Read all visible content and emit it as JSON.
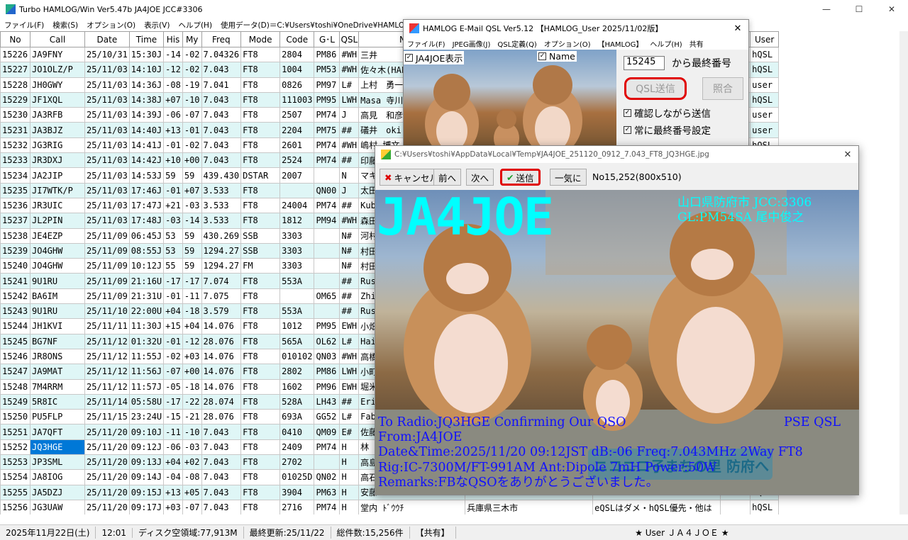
{
  "main_window": {
    "title": "Turbo HAMLOG/Win Ver5.47b JA4JOE JCC#3306",
    "controls": [
      "—",
      "☐",
      "✕"
    ],
    "menu": [
      "ファイル(F)",
      "検索(S)",
      "オプション(O)",
      "表示(V)",
      "ヘルプ(H)",
      "使用データ(D)＝C:¥Users¥toshi¥OneDrive¥HAMLOG¥Hamlog.hdb",
      "再"
    ]
  },
  "log": {
    "columns": [
      "No",
      "Call",
      "Date",
      "Time",
      "His",
      "My",
      "Freq",
      "Mode",
      "Code",
      "G･L",
      "QSL",
      "Name",
      "",
      "Remarks２",
      "DC12",
      "User"
    ],
    "rows": [
      [
        "15226",
        "JA9FNY",
        "25/10/31",
        "15:30J",
        "-14",
        "-02",
        "7.04326",
        "FT8",
        "2804",
        "PM86",
        "#WH",
        "三井",
        "",
        "対応。h-QSL、e-QSL、",
        "",
        "hQSL"
      ],
      [
        "15227",
        "JO1OLZ/P",
        "25/11/03",
        "14:10J",
        "-12",
        "-02",
        "7.043",
        "FT8",
        "1004",
        "PM53",
        "#WH",
        "佐々木(HAL)",
        "",
        "ろ勉強中,CW QRQ聴取も",
        "",
        "hQSL"
      ],
      [
        "15228",
        "JH0GWY",
        "25/11/03",
        "14:36J",
        "-08",
        "-19",
        "7.041",
        "FT8",
        "0826",
        "PM97",
        "L#",
        "上村　勇一",
        "",
        "7KB",
        "",
        "user"
      ],
      [
        "15229",
        "JF1XQL",
        "25/11/03",
        "14:38J",
        "+07",
        "-10",
        "7.043",
        "FT8",
        "111003",
        "PM95",
        "LWH",
        "Masa 寺川",
        "",
        "SLはH-QSL,e-QSL。紙",
        "",
        "hQSL"
      ],
      [
        "15230",
        "JA3RFB",
        "25/11/03",
        "14:39J",
        "-06",
        "-07",
        "7.043",
        "FT8",
        "2507",
        "PM74",
        "J",
        "高見　和彦",
        "",
        "がとうございました。",
        "",
        "user"
      ],
      [
        "15231",
        "JA3BJZ",
        "25/11/03",
        "14:40J",
        "+13",
        "-01",
        "7.043",
        "FT8",
        "2204",
        "PM75",
        "##",
        "礒井　oki",
        "",
        "インに出ています",
        "",
        "user"
      ],
      [
        "15232",
        "JG3RIG",
        "25/11/03",
        "14:41J",
        "-01",
        "-02",
        "7.043",
        "FT8",
        "2601",
        "PM74",
        "#WH",
        "嶋村 博文",
        "",
        "QSO CL 73 88  HAMLO",
        "",
        "hQSL"
      ],
      [
        "15233",
        "JR3DXJ",
        "25/11/03",
        "14:42J",
        "+10",
        "+00",
        "7.043",
        "FT8",
        "2524",
        "PM74",
        "##",
        "印藤",
        "",
        "",
        "",
        "hQSL"
      ],
      [
        "15234",
        "JA2JIP",
        "25/11/03",
        "14:53J",
        "59",
        "59",
        "439.430",
        "DSTAR",
        "2007",
        "",
        "N",
        "マキタ",
        "",
        "",
        "",
        ""
      ],
      [
        "15235",
        "JI7WTK/P",
        "25/11/03",
        "17:46J",
        "-01",
        "+07",
        "3.533",
        "FT8",
        "",
        "QN00",
        "J",
        "太田",
        "",
        "",
        "",
        "user"
      ],
      [
        "15236",
        "JR3UIC",
        "25/11/03",
        "17:47J",
        "+21",
        "-03",
        "3.533",
        "FT8",
        "24004",
        "PM74",
        "##",
        "Kubo",
        "",
        "",
        "",
        "hQSL"
      ],
      [
        "15237",
        "JL2PIN",
        "25/11/03",
        "17:48J",
        "-03",
        "-14",
        "3.533",
        "FT8",
        "1812",
        "PM94",
        "#WH",
        "森田",
        "",
        "",
        "",
        "hQSL"
      ],
      [
        "15238",
        "JE4EZP",
        "25/11/09",
        "06:45J",
        "53",
        "59",
        "430.269",
        "SSB",
        "3303",
        "",
        "N#",
        "河村",
        "",
        "",
        "",
        "user"
      ],
      [
        "15239",
        "JO4GHW",
        "25/11/09",
        "08:55J",
        "53",
        "59",
        "1294.27",
        "SSB",
        "3303",
        "",
        "N#",
        "村田伸",
        "",
        "",
        "",
        "user"
      ],
      [
        "15240",
        "JO4GHW",
        "25/11/09",
        "10:12J",
        "55",
        "59",
        "1294.27",
        "FM",
        "3303",
        "",
        "N#",
        "村田伸",
        "",
        "",
        "",
        "user"
      ],
      [
        "15241",
        "9U1RU",
        "25/11/09",
        "21:16U",
        "-17",
        "-17",
        "7.074",
        "FT8",
        "553A",
        "",
        "##",
        "Russi",
        "",
        "",
        "",
        "hQSL"
      ],
      [
        "15242",
        "BA6IM",
        "25/11/09",
        "21:31U",
        "-01",
        "-11",
        "7.075",
        "FT8",
        "",
        "OM65",
        "##",
        "Zhiyo",
        "",
        "",
        "",
        ""
      ],
      [
        "15243",
        "9U1RU",
        "25/11/10",
        "22:00U",
        "+04",
        "-18",
        "3.579",
        "FT8",
        "553A",
        "",
        "##",
        "Russi",
        "",
        "",
        "",
        "hQSL"
      ],
      [
        "15244",
        "JH1KVI",
        "25/11/11",
        "11:30J",
        "+15",
        "+04",
        "14.076",
        "FT8",
        "1012",
        "PM95",
        "EWH",
        "小畑",
        "",
        "",
        "",
        "hQSL"
      ],
      [
        "15245",
        "BG7NF",
        "25/11/12",
        "01:32U",
        "-01",
        "-12",
        "28.076",
        "FT8",
        "565A",
        "OL62",
        "L#",
        "Haib",
        "",
        "",
        "",
        ""
      ],
      [
        "15246",
        "JR8ONS",
        "25/11/12",
        "11:55J",
        "-02",
        "+03",
        "14.076",
        "FT8",
        "010102",
        "QN03",
        "#WH",
        "高橋",
        "",
        "",
        "",
        "hQSL"
      ],
      [
        "15247",
        "JA9MAT",
        "25/11/12",
        "11:56J",
        "-07",
        "+00",
        "14.076",
        "FT8",
        "2802",
        "PM86",
        "LWH",
        "小町",
        "",
        "",
        "",
        "hQSL"
      ],
      [
        "15248",
        "7M4RRM",
        "25/11/12",
        "11:57J",
        "-05",
        "-18",
        "14.076",
        "FT8",
        "1602",
        "PM96",
        "EWH",
        "堀米",
        "",
        "",
        "",
        "hQSL"
      ],
      [
        "15249",
        "5R8IC",
        "25/11/14",
        "05:58U",
        "-17",
        "-22",
        "28.074",
        "FT8",
        "528A",
        "LH43",
        "##",
        "Eric",
        "",
        "",
        "",
        "hQSL"
      ],
      [
        "15250",
        "PU5FLP",
        "25/11/15",
        "23:24U",
        "-15",
        "-21",
        "28.076",
        "FT8",
        "693A",
        "GG52",
        "L#",
        "Fabio",
        "",
        "",
        "",
        "hQSL"
      ],
      [
        "15251",
        "JA7QFT",
        "25/11/20",
        "09:10J",
        "-11",
        "-10",
        "7.043",
        "FT8",
        "0410",
        "QM09",
        "E#",
        "佐藤",
        "",
        "",
        "",
        "user"
      ],
      [
        "15252",
        "JQ3HGE",
        "25/11/20",
        "09:12J",
        "-06",
        "-03",
        "7.043",
        "FT8",
        "2409",
        "PM74",
        "H",
        "林　秀",
        "",
        "",
        "",
        "hQSL"
      ],
      [
        "15253",
        "JP3SML",
        "25/11/20",
        "09:13J",
        "+04",
        "+02",
        "7.043",
        "FT8",
        "2702",
        "",
        "H",
        "高島",
        "",
        "",
        "",
        "hQSL"
      ],
      [
        "15254",
        "JA8IOG",
        "25/11/20",
        "09:14J",
        "-04",
        "-08",
        "7.043",
        "FT8",
        "01025D",
        "QN02",
        "H",
        "高石",
        "",
        "",
        "",
        "hQSL"
      ],
      [
        "15255",
        "JA5DZJ",
        "25/11/20",
        "09:15J",
        "+13",
        "+05",
        "7.043",
        "FT8",
        "3904",
        "PM63",
        "H",
        "安藤",
        "",
        "",
        "",
        "hQSL"
      ],
      [
        "15256",
        "JG3UAW",
        "25/11/20",
        "09:17J",
        "+03",
        "-07",
        "7.043",
        "FT8",
        "2716",
        "PM74",
        "H",
        "堂内 ﾄﾞｳｳﾁ",
        "兵庫県三木市",
        "eQSLはダメ・hQSL優先・他は",
        "",
        "hQSL"
      ]
    ],
    "selected_row": 26
  },
  "statusbar": [
    "2025年11月22日(土)",
    "12:01",
    "ディスク空領域:77,913M",
    "最終更新:25/11/22",
    "総件数:15,256件",
    "【共有】",
    "★ User ＪＡ４ＪＯＥ ★"
  ],
  "email_dialog": {
    "title": "HAMLOG E-Mail QSL Ver5.12 【HAMLOG_User 2025/11/02版】",
    "menu": [
      "ファイル(F)",
      "JPEG画像(J)",
      "QSL定義(Q)",
      "オプション(O)",
      "【HAMLOG】",
      "ヘルプ(H)",
      "共有"
    ],
    "show_call_label": "JA4JOE表示",
    "name_label": "Name",
    "start_number": "15245",
    "from_last_label": "から最終番号",
    "send_button": "QSL送信",
    "check_button": "照合",
    "confirm_label": "確認しながら送信",
    "always_last_label": "常に最終番号設定"
  },
  "preview": {
    "title": "C:¥Users¥toshi¥AppData¥Local¥Temp¥JA4JOE_251120_0912_7.043_FT8_JQ3HGE.jpg",
    "cancel": "キャンセル",
    "prev": "前へ",
    "next": "次へ",
    "send": "送信",
    "all_at_once": "一気に",
    "info": "No15,252(800x510)",
    "card": {
      "callsign": "JA4JOE",
      "location": "山口県防府市 JCC:3306",
      "grid": "GL:PM54SA  尾中俊之",
      "to_line": "To Radio:JQ3HGE  Confirming Our QSO",
      "pse": "PSE QSL",
      "from_line": "From:JA4JOE",
      "date_line": "Date&Time:2025/11/20 09:12JST dB:-06 Freq:7.043MHz 2Way FT8",
      "rig_line": "Rig:IC-7300M/FT-991AM Ant:Dipole 7mH Power:50W",
      "remarks_line": "Remarks:FBなQSOをありがとうございました。",
      "sign_text": "ニコニコ子まちの里 防府へ"
    }
  },
  "colors": {
    "alt_row": "#dff6f6",
    "selection": "#0078d7",
    "cyan_text": "#00ffff",
    "blue_text": "#1010ff",
    "highlight_ring": "#e00000"
  }
}
